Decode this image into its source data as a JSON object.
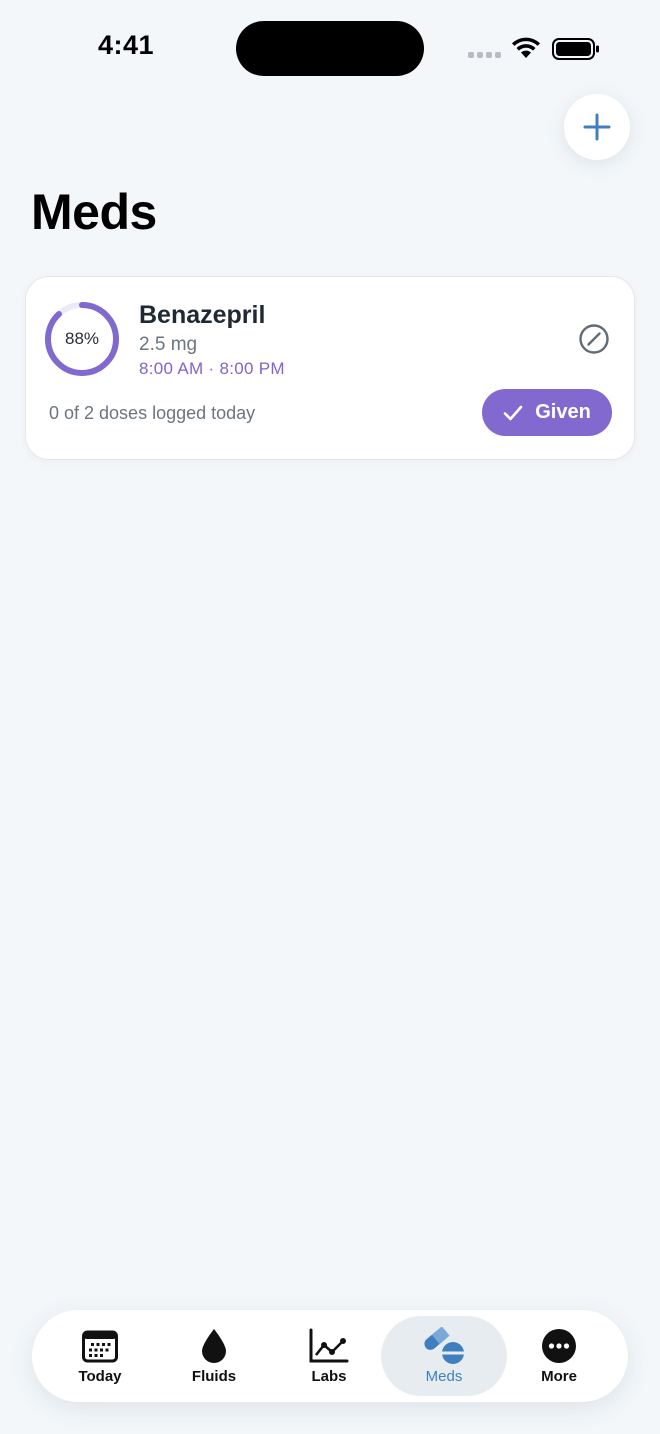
{
  "status_bar": {
    "time": "4:41"
  },
  "header": {
    "title": "Meds",
    "add_icon": "plus-icon"
  },
  "medications": [
    {
      "adherence_percent": 88,
      "adherence_label": "88%",
      "name": "Benazepril",
      "dose": "2.5 mg",
      "times": "8:00 AM · 8:00 PM",
      "doses_logged": "0 of 2 doses logged today",
      "given_label": "Given",
      "edit_icon": "edit-icon"
    }
  ],
  "tab_bar": {
    "tabs": [
      {
        "label": "Today",
        "icon": "calendar-icon"
      },
      {
        "label": "Fluids",
        "icon": "drop-icon"
      },
      {
        "label": "Labs",
        "icon": "chart-icon"
      },
      {
        "label": "Meds",
        "icon": "pills-icon",
        "active": true
      },
      {
        "label": "More",
        "icon": "more-icon"
      }
    ]
  },
  "colors": {
    "accent_purple": "#8169cf",
    "accent_blue": "#3f7fc0",
    "background": "#f3f7fa"
  }
}
